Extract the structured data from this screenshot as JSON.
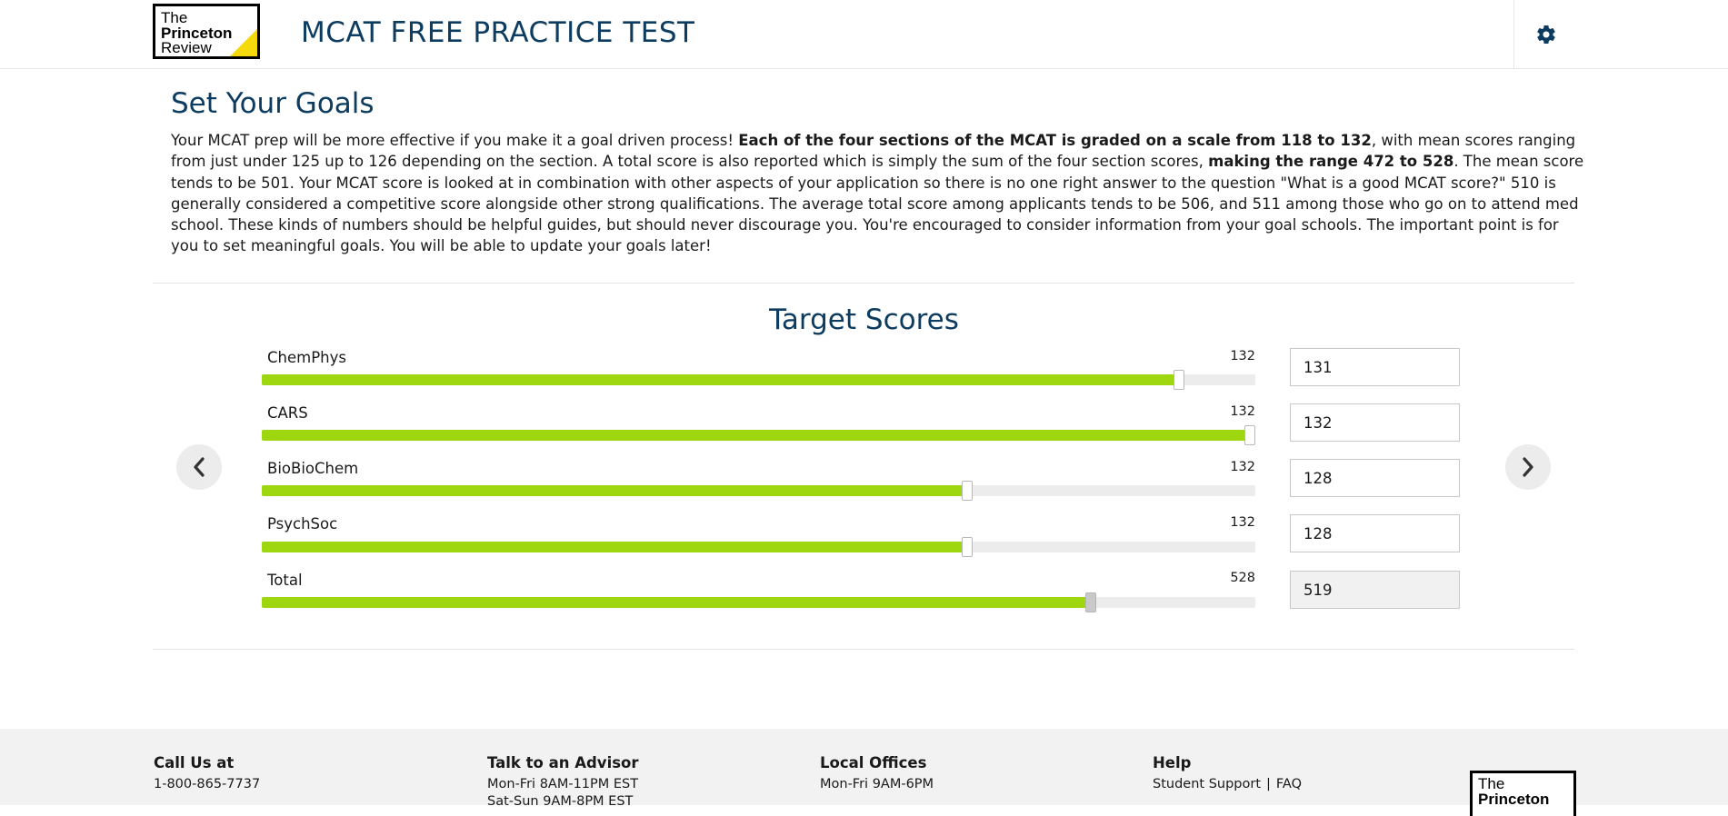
{
  "header": {
    "logo": {
      "line1": "The",
      "line2": "Princeton",
      "line3": "Review"
    },
    "title": "MCAT FREE PRACTICE TEST",
    "settings_icon": "gear-icon"
  },
  "intro": {
    "heading": "Set Your Goals",
    "p1": "Your MCAT prep will be more effective if you make it a goal driven process! ",
    "b1": "Each of the four sections of the MCAT is graded on a scale from 118 to 132",
    "p2": ", with mean scores ranging from just under 125 up to 126 depending on the section. A total score is also reported which is simply the sum of the four section scores, ",
    "b2": "making the range 472 to 528",
    "p3": ". The mean score tends to be 501. Your MCAT score is looked at in combination with other aspects of your application so there is no one right answer to the question \"What is a good MCAT score?\" 510 is generally considered a competitive score alongside other strong qualifications. The average total score among applicants tends to be 506, and 511 among those who go on to attend med school. These kinds of numbers should be helpful guides, but should never discourage you. You're encouraged to consider information from your goal schools. The important point is for you to set meaningful goals. You will be able to update your goals later!"
  },
  "target": {
    "title": "Target Scores",
    "rows": [
      {
        "label": "ChemPhys",
        "max": "132",
        "value": "131",
        "fraction": 0.9236
      },
      {
        "label": "CARS",
        "max": "132",
        "value": "132",
        "fraction": 0.9945
      },
      {
        "label": "BioBioChem",
        "max": "132",
        "value": "128",
        "fraction": 0.7101
      },
      {
        "label": "PsychSoc",
        "max": "132",
        "value": "128",
        "fraction": 0.7101
      }
    ],
    "total": {
      "label": "Total",
      "max": "528",
      "value": "519",
      "fraction": 0.8347
    },
    "prev_icon": "chevron-left-icon",
    "next_icon": "chevron-right-icon",
    "slider_color": "#9ed60f"
  },
  "footer": {
    "call": {
      "title": "Call Us at",
      "phone": "1-800-865-7737"
    },
    "advisor": {
      "title": "Talk to an Advisor",
      "hours1": "Mon-Fri 8AM-11PM EST",
      "hours2": "Sat-Sun 9AM-8PM EST"
    },
    "offices": {
      "title": "Local Offices",
      "hours": "Mon-Fri 9AM-6PM"
    },
    "help": {
      "title": "Help",
      "support": "Student Support",
      "separator": "|",
      "faq": "FAQ"
    },
    "logo": {
      "line1": "The",
      "line2": "Princeton"
    }
  },
  "colors": {
    "brand_navy": "#0c3c60",
    "accent_green": "#9ed60f",
    "logo_yellow": "#f5d90a"
  }
}
